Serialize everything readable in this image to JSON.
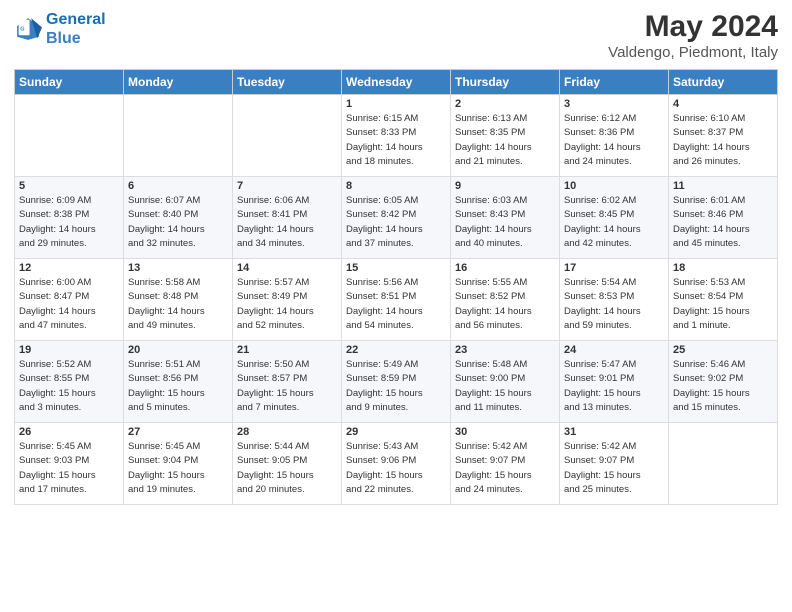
{
  "header": {
    "logo_line1": "General",
    "logo_line2": "Blue",
    "month_year": "May 2024",
    "location": "Valdengo, Piedmont, Italy"
  },
  "days_of_week": [
    "Sunday",
    "Monday",
    "Tuesday",
    "Wednesday",
    "Thursday",
    "Friday",
    "Saturday"
  ],
  "weeks": [
    [
      {
        "day": "",
        "info": ""
      },
      {
        "day": "",
        "info": ""
      },
      {
        "day": "",
        "info": ""
      },
      {
        "day": "1",
        "info": "Sunrise: 6:15 AM\nSunset: 8:33 PM\nDaylight: 14 hours\nand 18 minutes."
      },
      {
        "day": "2",
        "info": "Sunrise: 6:13 AM\nSunset: 8:35 PM\nDaylight: 14 hours\nand 21 minutes."
      },
      {
        "day": "3",
        "info": "Sunrise: 6:12 AM\nSunset: 8:36 PM\nDaylight: 14 hours\nand 24 minutes."
      },
      {
        "day": "4",
        "info": "Sunrise: 6:10 AM\nSunset: 8:37 PM\nDaylight: 14 hours\nand 26 minutes."
      }
    ],
    [
      {
        "day": "5",
        "info": "Sunrise: 6:09 AM\nSunset: 8:38 PM\nDaylight: 14 hours\nand 29 minutes."
      },
      {
        "day": "6",
        "info": "Sunrise: 6:07 AM\nSunset: 8:40 PM\nDaylight: 14 hours\nand 32 minutes."
      },
      {
        "day": "7",
        "info": "Sunrise: 6:06 AM\nSunset: 8:41 PM\nDaylight: 14 hours\nand 34 minutes."
      },
      {
        "day": "8",
        "info": "Sunrise: 6:05 AM\nSunset: 8:42 PM\nDaylight: 14 hours\nand 37 minutes."
      },
      {
        "day": "9",
        "info": "Sunrise: 6:03 AM\nSunset: 8:43 PM\nDaylight: 14 hours\nand 40 minutes."
      },
      {
        "day": "10",
        "info": "Sunrise: 6:02 AM\nSunset: 8:45 PM\nDaylight: 14 hours\nand 42 minutes."
      },
      {
        "day": "11",
        "info": "Sunrise: 6:01 AM\nSunset: 8:46 PM\nDaylight: 14 hours\nand 45 minutes."
      }
    ],
    [
      {
        "day": "12",
        "info": "Sunrise: 6:00 AM\nSunset: 8:47 PM\nDaylight: 14 hours\nand 47 minutes."
      },
      {
        "day": "13",
        "info": "Sunrise: 5:58 AM\nSunset: 8:48 PM\nDaylight: 14 hours\nand 49 minutes."
      },
      {
        "day": "14",
        "info": "Sunrise: 5:57 AM\nSunset: 8:49 PM\nDaylight: 14 hours\nand 52 minutes."
      },
      {
        "day": "15",
        "info": "Sunrise: 5:56 AM\nSunset: 8:51 PM\nDaylight: 14 hours\nand 54 minutes."
      },
      {
        "day": "16",
        "info": "Sunrise: 5:55 AM\nSunset: 8:52 PM\nDaylight: 14 hours\nand 56 minutes."
      },
      {
        "day": "17",
        "info": "Sunrise: 5:54 AM\nSunset: 8:53 PM\nDaylight: 14 hours\nand 59 minutes."
      },
      {
        "day": "18",
        "info": "Sunrise: 5:53 AM\nSunset: 8:54 PM\nDaylight: 15 hours\nand 1 minute."
      }
    ],
    [
      {
        "day": "19",
        "info": "Sunrise: 5:52 AM\nSunset: 8:55 PM\nDaylight: 15 hours\nand 3 minutes."
      },
      {
        "day": "20",
        "info": "Sunrise: 5:51 AM\nSunset: 8:56 PM\nDaylight: 15 hours\nand 5 minutes."
      },
      {
        "day": "21",
        "info": "Sunrise: 5:50 AM\nSunset: 8:57 PM\nDaylight: 15 hours\nand 7 minutes."
      },
      {
        "day": "22",
        "info": "Sunrise: 5:49 AM\nSunset: 8:59 PM\nDaylight: 15 hours\nand 9 minutes."
      },
      {
        "day": "23",
        "info": "Sunrise: 5:48 AM\nSunset: 9:00 PM\nDaylight: 15 hours\nand 11 minutes."
      },
      {
        "day": "24",
        "info": "Sunrise: 5:47 AM\nSunset: 9:01 PM\nDaylight: 15 hours\nand 13 minutes."
      },
      {
        "day": "25",
        "info": "Sunrise: 5:46 AM\nSunset: 9:02 PM\nDaylight: 15 hours\nand 15 minutes."
      }
    ],
    [
      {
        "day": "26",
        "info": "Sunrise: 5:45 AM\nSunset: 9:03 PM\nDaylight: 15 hours\nand 17 minutes."
      },
      {
        "day": "27",
        "info": "Sunrise: 5:45 AM\nSunset: 9:04 PM\nDaylight: 15 hours\nand 19 minutes."
      },
      {
        "day": "28",
        "info": "Sunrise: 5:44 AM\nSunset: 9:05 PM\nDaylight: 15 hours\nand 20 minutes."
      },
      {
        "day": "29",
        "info": "Sunrise: 5:43 AM\nSunset: 9:06 PM\nDaylight: 15 hours\nand 22 minutes."
      },
      {
        "day": "30",
        "info": "Sunrise: 5:42 AM\nSunset: 9:07 PM\nDaylight: 15 hours\nand 24 minutes."
      },
      {
        "day": "31",
        "info": "Sunrise: 5:42 AM\nSunset: 9:07 PM\nDaylight: 15 hours\nand 25 minutes."
      },
      {
        "day": "",
        "info": ""
      }
    ]
  ]
}
